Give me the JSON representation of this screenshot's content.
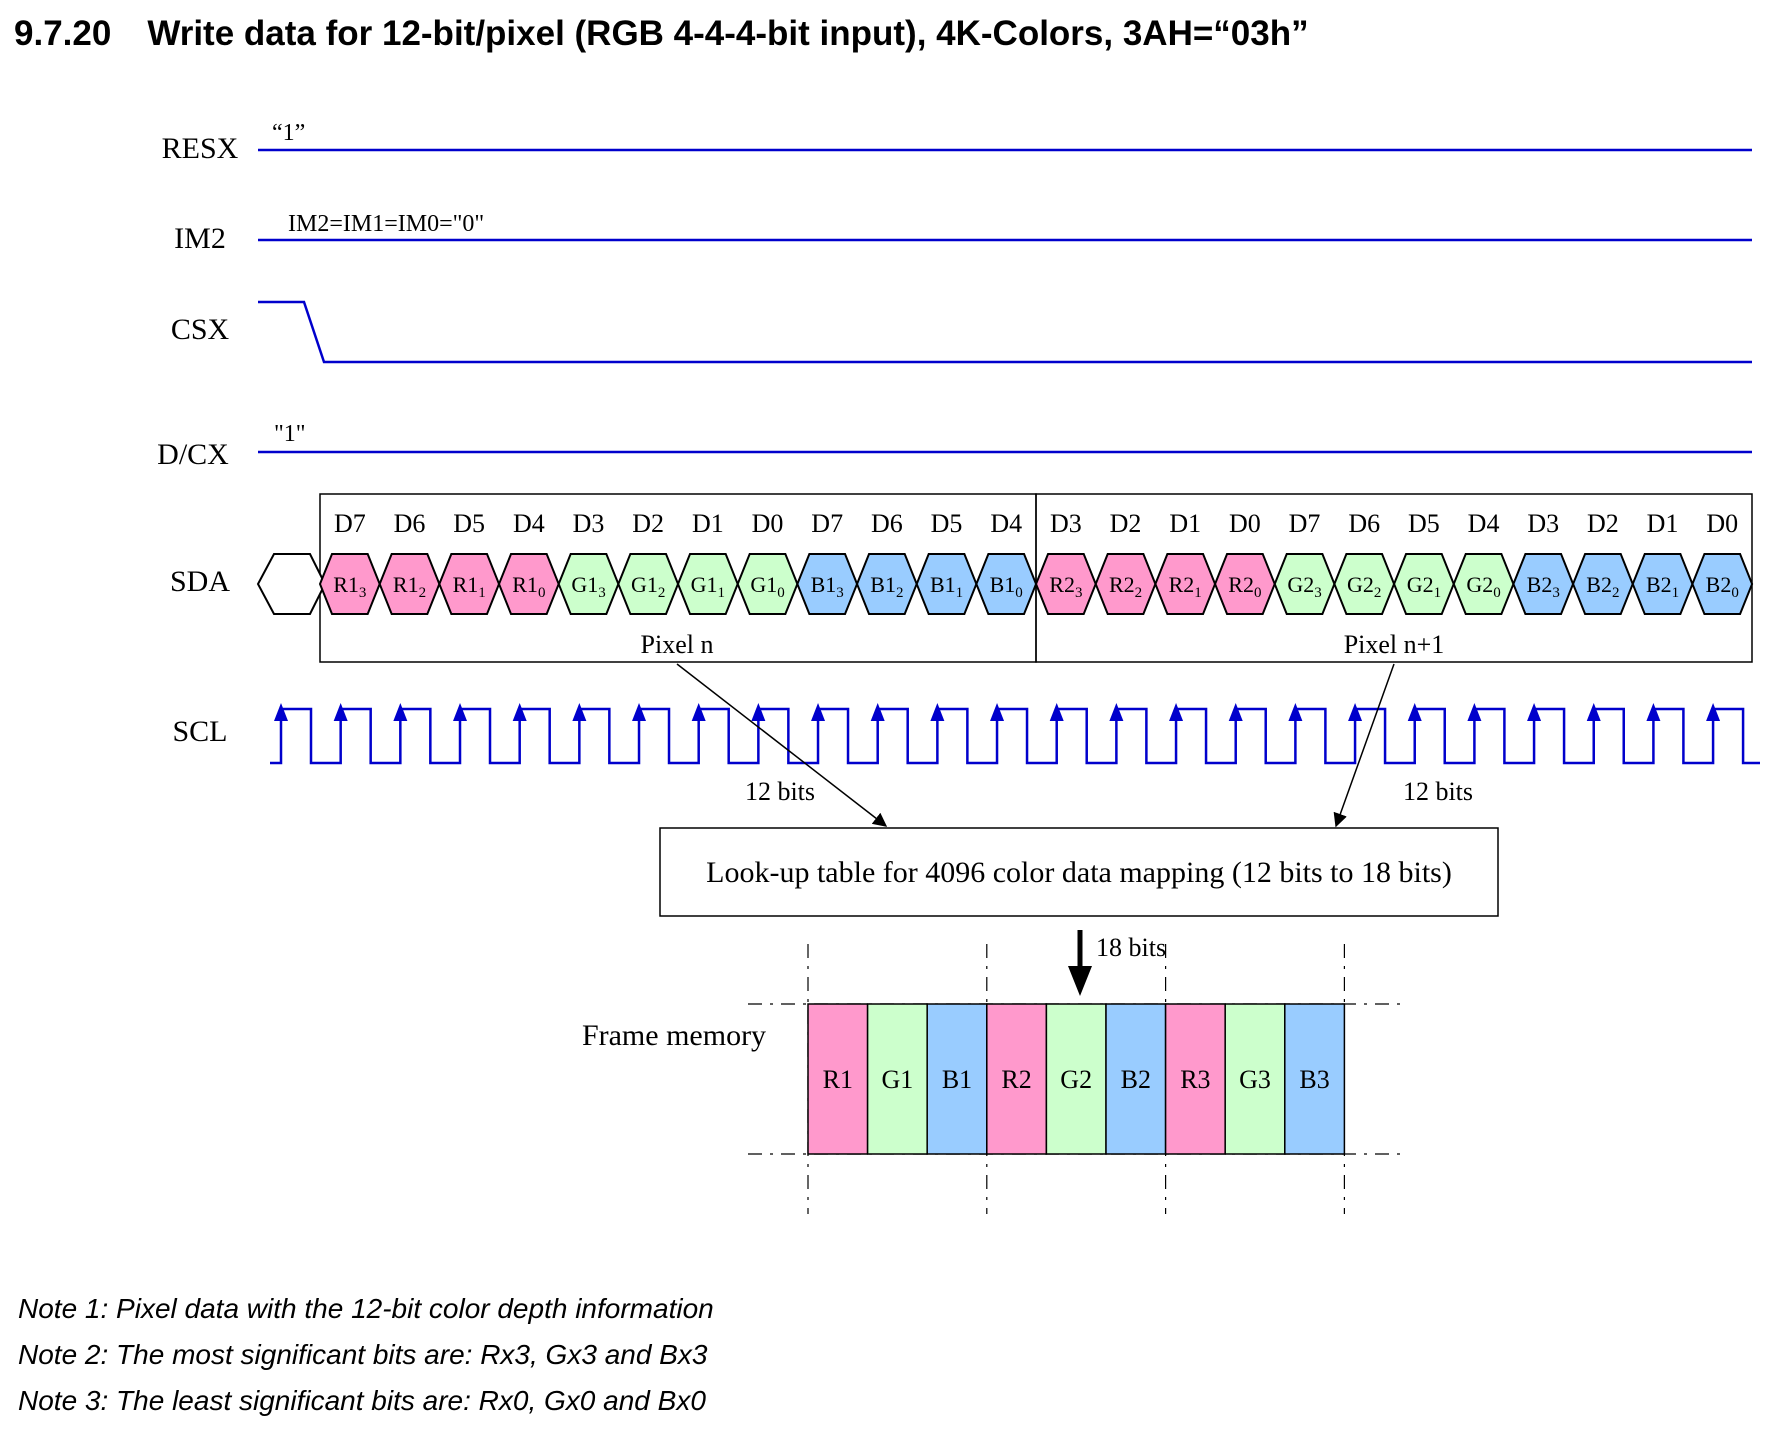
{
  "section_title": {
    "number": "9.7.20",
    "text": "Write data for 12-bit/pixel (RGB 4-4-4-bit input), 4K-Colors, 3AH=“03h”"
  },
  "signals": {
    "resx": {
      "label": "RESX",
      "state": "“1”"
    },
    "im2": {
      "label": "IM2",
      "state": "IM2=IM1=IM0=\"0\""
    },
    "csx": {
      "label": "CSX"
    },
    "dcx": {
      "label": "D/CX",
      "state": "\"1\""
    },
    "sda": {
      "label": "SDA"
    },
    "scl": {
      "label": "SCL"
    }
  },
  "bit_headers": [
    "D7",
    "D6",
    "D5",
    "D4",
    "D3",
    "D2",
    "D1",
    "D0",
    "D7",
    "D6",
    "D5",
    "D4",
    "D3",
    "D2",
    "D1",
    "D0",
    "D7",
    "D6",
    "D5",
    "D4",
    "D3",
    "D2",
    "D1",
    "D0"
  ],
  "sda_cells": [
    {
      "base": "R1",
      "sub": "3",
      "color": "red"
    },
    {
      "base": "R1",
      "sub": "2",
      "color": "red"
    },
    {
      "base": "R1",
      "sub": "1",
      "color": "red"
    },
    {
      "base": "R1",
      "sub": "0",
      "color": "red"
    },
    {
      "base": "G1",
      "sub": "3",
      "color": "green"
    },
    {
      "base": "G1",
      "sub": "2",
      "color": "green"
    },
    {
      "base": "G1",
      "sub": "1",
      "color": "green"
    },
    {
      "base": "G1",
      "sub": "0",
      "color": "green"
    },
    {
      "base": "B1",
      "sub": "3",
      "color": "blue"
    },
    {
      "base": "B1",
      "sub": "2",
      "color": "blue"
    },
    {
      "base": "B1",
      "sub": "1",
      "color": "blue"
    },
    {
      "base": "B1",
      "sub": "0",
      "color": "blue"
    },
    {
      "base": "R2",
      "sub": "3",
      "color": "red"
    },
    {
      "base": "R2",
      "sub": "2",
      "color": "red"
    },
    {
      "base": "R2",
      "sub": "1",
      "color": "red"
    },
    {
      "base": "R2",
      "sub": "0",
      "color": "red"
    },
    {
      "base": "G2",
      "sub": "3",
      "color": "green"
    },
    {
      "base": "G2",
      "sub": "2",
      "color": "green"
    },
    {
      "base": "G2",
      "sub": "1",
      "color": "green"
    },
    {
      "base": "G2",
      "sub": "0",
      "color": "green"
    },
    {
      "base": "B2",
      "sub": "3",
      "color": "blue"
    },
    {
      "base": "B2",
      "sub": "2",
      "color": "blue"
    },
    {
      "base": "B2",
      "sub": "1",
      "color": "blue"
    },
    {
      "base": "B2",
      "sub": "0",
      "color": "blue"
    }
  ],
  "pixel_labels": [
    "Pixel n",
    "Pixel n+1"
  ],
  "bits_labels": {
    "left": "12 bits",
    "right": "12 bits",
    "down": "18 bits"
  },
  "lut_label": "Look-up table for 4096 color data mapping (12 bits to 18 bits)",
  "frame_memory": {
    "label": "Frame memory",
    "cells": [
      {
        "text": "R1",
        "color": "red"
      },
      {
        "text": "G1",
        "color": "green"
      },
      {
        "text": "B1",
        "color": "blue"
      },
      {
        "text": "R2",
        "color": "red"
      },
      {
        "text": "G2",
        "color": "green"
      },
      {
        "text": "B2",
        "color": "blue"
      },
      {
        "text": "R3",
        "color": "red"
      },
      {
        "text": "G3",
        "color": "green"
      },
      {
        "text": "B3",
        "color": "blue"
      }
    ]
  },
  "colors": {
    "red": "#ff99cc",
    "green": "#ccffcc",
    "blue": "#99ccff",
    "signal": "#0000cc"
  },
  "notes": [
    "Note 1: Pixel data with the 12-bit color depth information",
    "Note 2: The most significant bits are: Rx3, Gx3 and Bx3",
    "Note 3: The least significant bits are: Rx0, Gx0 and Bx0"
  ]
}
